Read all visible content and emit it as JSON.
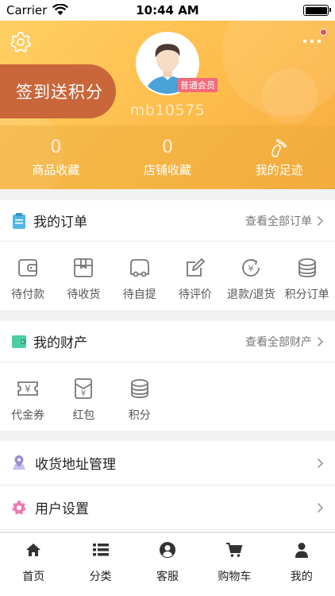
{
  "status_bar": {
    "carrier": "Carrier",
    "time": "10:44 AM"
  },
  "header": {
    "checkin_label": "签到送积分",
    "username": "mb10575",
    "member_badge": "普通会员",
    "stats": [
      {
        "value": "0",
        "label": "商品收藏"
      },
      {
        "value": "0",
        "label": "店铺收藏"
      },
      {
        "value": "",
        "label": "我的足迹",
        "icon": "footprint-icon"
      }
    ]
  },
  "orders": {
    "title": "我的订单",
    "view_all": "查看全部订单",
    "items": [
      {
        "label": "待付款",
        "icon": "wallet-icon"
      },
      {
        "label": "待收货",
        "icon": "package-icon"
      },
      {
        "label": "待自提",
        "icon": "truck-icon"
      },
      {
        "label": "待评价",
        "icon": "edit-icon"
      },
      {
        "label": "退款/退货",
        "icon": "refund-icon"
      },
      {
        "label": "积分订单",
        "icon": "coins-icon"
      }
    ]
  },
  "assets": {
    "title": "我的财产",
    "view_all": "查看全部财产",
    "items": [
      {
        "label": "代金券",
        "icon": "voucher-icon"
      },
      {
        "label": "红包",
        "icon": "red-envelope-icon"
      },
      {
        "label": "积分",
        "icon": "coins-icon"
      }
    ]
  },
  "menu_rows": [
    {
      "label": "收货地址管理",
      "icon": "map-pin-icon"
    },
    {
      "label": "用户设置",
      "icon": "gear-icon"
    }
  ],
  "tabbar": [
    {
      "label": "首页",
      "icon": "home-icon"
    },
    {
      "label": "分类",
      "icon": "list-icon"
    },
    {
      "label": "客服",
      "icon": "person-circle-icon"
    },
    {
      "label": "购物车",
      "icon": "cart-icon"
    },
    {
      "label": "我的",
      "icon": "user-icon"
    }
  ],
  "colors": {
    "header": "#fdbb4a",
    "checkin": "#c9663a",
    "badge": "#f36a7a",
    "order_icon": "#4fb6e6",
    "asset_icon": "#4ccfa0",
    "address_icon": "#9d8cd8",
    "settings_icon": "#ef7bb3"
  }
}
